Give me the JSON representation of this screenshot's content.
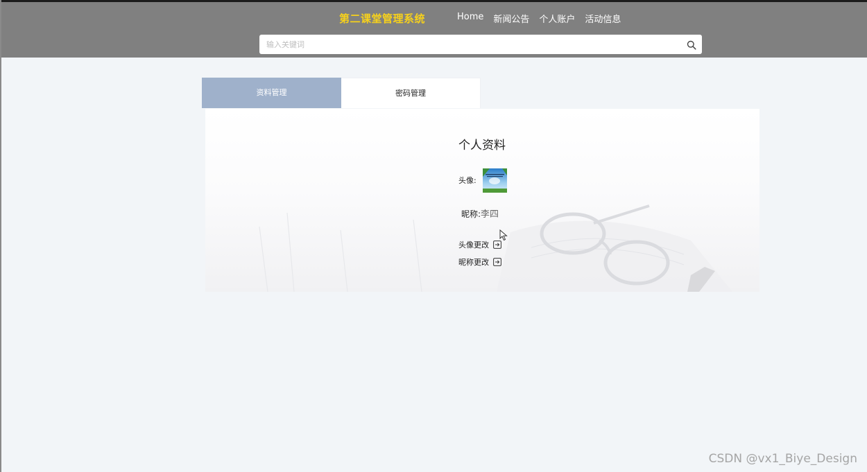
{
  "header": {
    "brand": "第二课堂管理系统",
    "nav": [
      "Home",
      "新闻公告",
      "个人账户",
      "活动信息"
    ],
    "search_placeholder": "输入关键词",
    "search_icon": "search-icon"
  },
  "tabs": [
    {
      "label": "资料管理",
      "active": true
    },
    {
      "label": "密码管理",
      "active": false
    }
  ],
  "profile": {
    "title": "个人资料",
    "avatar_label": "头像:",
    "nickname_label": "昵称:",
    "nickname_value": "李四",
    "change_avatar": "头像更改",
    "change_nickname": "昵称更改"
  },
  "watermark": "CSDN @vx1_Biye_Design",
  "colors": {
    "header_bg": "#808080",
    "brand": "#f7d11b",
    "tab_active": "#9fb1cb",
    "page_bg": "#f2f5f8"
  }
}
